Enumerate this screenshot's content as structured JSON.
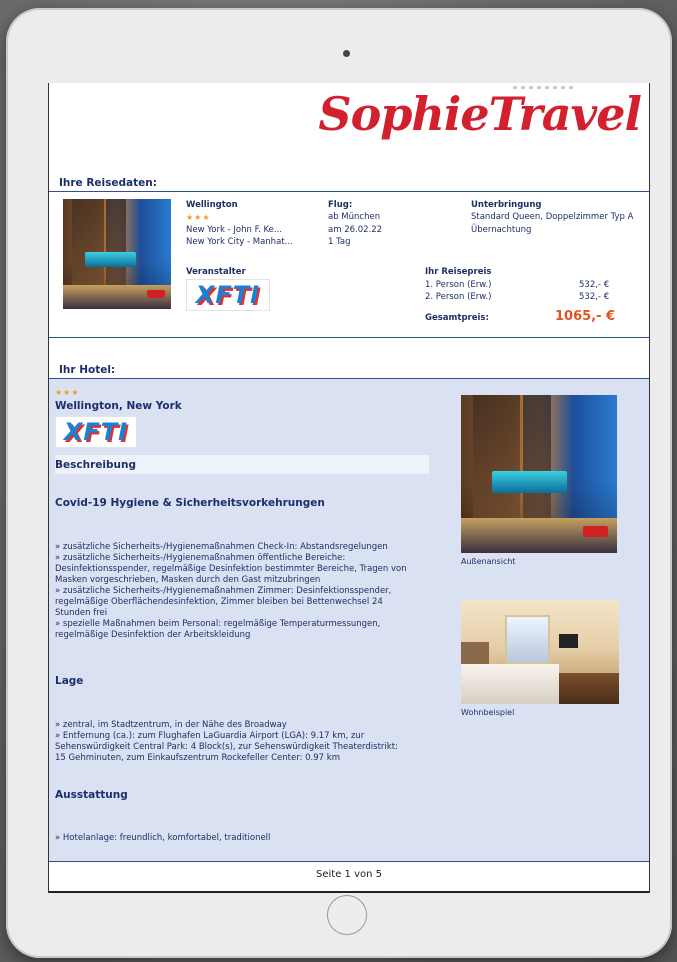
{
  "logo": {
    "text": "SophieTravel"
  },
  "booking": {
    "section_title": "Ihre Reisedaten:",
    "hotel_name": "Wellington",
    "stars": "★★★",
    "route_1": "New York - John F. Ke...",
    "route_2": "New York City - Manhat...",
    "flight_label": "Flug:",
    "flight_from": "ab München",
    "flight_date": "am 26.02.22",
    "flight_duration": "1 Tag",
    "accommodation_label": "Unterbringung",
    "room_type": "Standard Queen, Doppelzimmer Typ A",
    "board": "Übernachtung",
    "operator_label": "Veranstalter",
    "operator_logo": "XFTI",
    "price_label": "Ihr Reisepreis",
    "persons": [
      {
        "label": "1. Person (Erw.)",
        "price": "532,- €"
      },
      {
        "label": "2. Person (Erw.)",
        "price": "532,- €"
      }
    ],
    "total_label": "Gesamtpreis:",
    "total_price": "1065,- €"
  },
  "hotel": {
    "section_title": "Ihr Hotel:",
    "stars": "★★★",
    "name": "Wellington, New York",
    "logo": "XFTI",
    "description_label": "Beschreibung",
    "covid_title": "Covid-19 Hygiene & Sicherheitsvorkehrungen",
    "covid_lines": [
      " » zusätzliche Sicherheits-/Hygienemaßnahmen Check-In: Abstandsregelungen",
      " » zusätzliche Sicherheits-/Hygienemaßnahmen öffentliche Bereiche:",
      "Desinfektionsspender, regelmäßige Desinfektion bestimmter Bereiche, Tragen von",
      "Masken vorgeschrieben, Masken durch den Gast mitzubringen",
      " » zusätzliche Sicherheits-/Hygienemaßnahmen Zimmer: Desinfektionsspender,",
      "regelmäßige Oberflächendesinfektion, Zimmer bleiben bei Bettenwechsel 24",
      "Stunden frei",
      " » spezielle Maßnahmen beim Personal: regelmäßige Temperaturmessungen,",
      "regelmäßige Desinfektion der Arbeitskleidung"
    ],
    "location_title": "Lage",
    "location_lines": [
      " » zentral, im Stadtzentrum, in der Nähe des Broadway",
      " » Entfernung (ca.): zum Flughafen LaGuardia Airport (LGA): 9.17 km, zur",
      "Sehenswürdigkeit Central Park: 4 Block(s), zur Sehenswürdigkeit Theaterdistrikt:",
      "15 Gehminuten, zum Einkaufszentrum Rockefeller Center: 0.97 km"
    ],
    "amenities_title": "Ausstattung",
    "amenities_lines": [
      " » Hotelanlage: freundlich, komfortabel, traditionell"
    ],
    "img1_caption": "Außenansicht",
    "img2_caption": "Wohnbeispiel"
  },
  "footer": {
    "page": "Seite 1 von 5"
  }
}
